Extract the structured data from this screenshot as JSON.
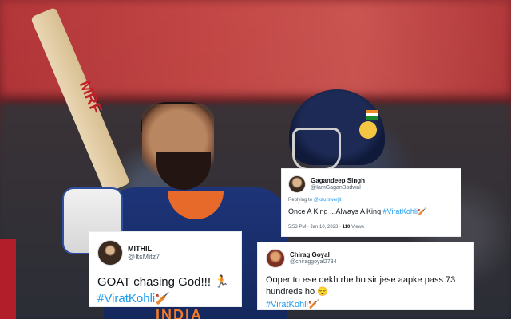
{
  "photo": {
    "bat_logo": "MRF",
    "jersey_text": "INDIA"
  },
  "tweets": [
    {
      "name": "Gagandeep Singh",
      "handle": "@IamGaganBadwal",
      "reply_prefix": "Replying to ",
      "reply_to": "@kaurswerjit",
      "text": "Once A King ...Always A King ",
      "hashtag": "#ViratKohli",
      "hashtag_emoji": "🏏",
      "time": "5:53 PM · Jan 10, 2023 · ",
      "views": "110",
      "views_label": " Views"
    },
    {
      "name": "MITHIL",
      "handle": "@ItsMitz7",
      "text": "GOAT chasing God!!! ",
      "text_emoji": "🏃",
      "hashtag": "#ViratKohli",
      "hashtag_emoji": "🏏"
    },
    {
      "name": "Chirag Goyal",
      "handle": "@chiraggoyal2734",
      "text": "Ooper to ese dekh rhe ho sir jese aapke pass 73 hundreds ho ",
      "text_emoji": "😌",
      "hashtag": "#ViratKohli",
      "hashtag_emoji": "🏏"
    }
  ],
  "colors": {
    "link": "#1d9bf0",
    "jersey": "#1d3478",
    "banner": "#c94a48"
  }
}
